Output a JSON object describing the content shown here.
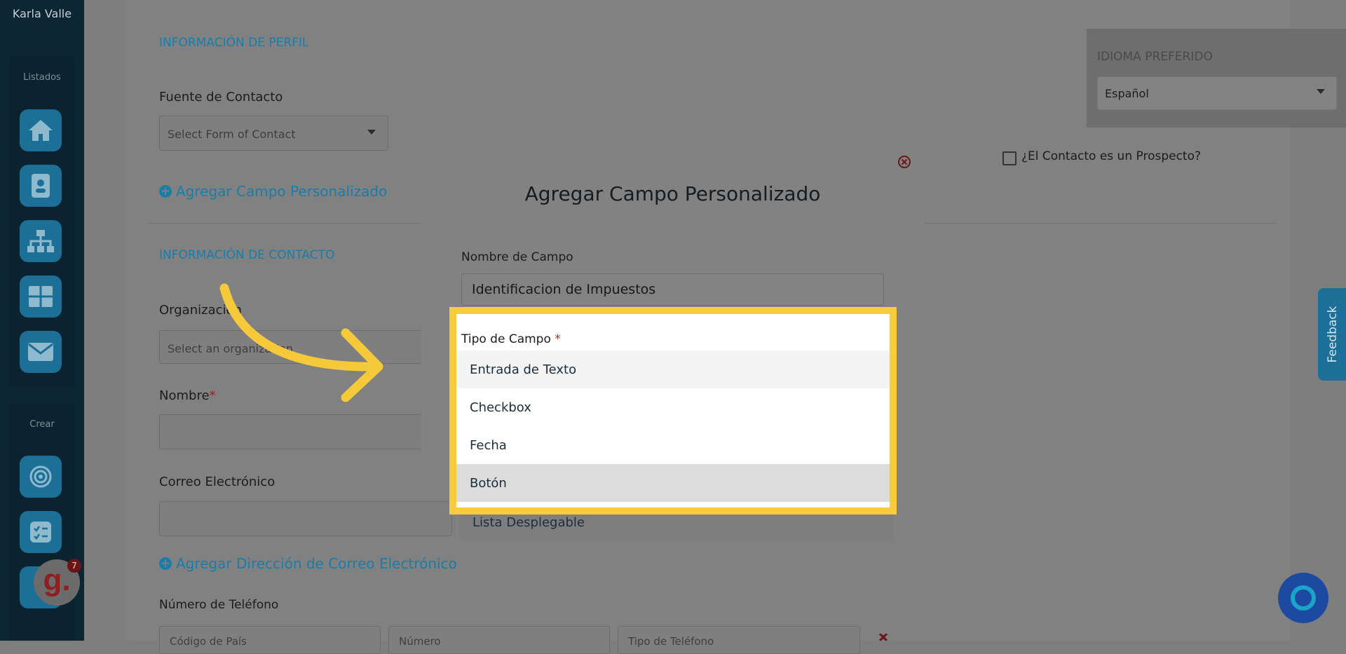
{
  "sidebar": {
    "user_name": "Karla Valle",
    "listados_heading": "Listados",
    "crear_heading": "Crear",
    "items": [
      {
        "icon": "home-icon"
      },
      {
        "icon": "contact-card-icon"
      },
      {
        "icon": "org-chart-icon"
      },
      {
        "icon": "dashboard-grid-icon"
      },
      {
        "icon": "mail-icon"
      },
      {
        "icon": "target-icon"
      },
      {
        "icon": "checklist-icon"
      }
    ],
    "badge_count": "7",
    "badge_letter": "g."
  },
  "profile": {
    "section_title": "INFORMACIÓN DE PERFIL",
    "contact_source_label": "Fuente de Contacto",
    "contact_source_placeholder": "Select Form of Contact",
    "add_custom_field_link": "Agregar Campo Personalizado",
    "preferred_language_label": "IDIOMA PREFERIDO",
    "preferred_language_value": "Español",
    "prospect_label": "¿El Contacto es un Prospecto?"
  },
  "contact": {
    "section_title": "INFORMACIÓN DE CONTACTO",
    "organization_label": "Organización",
    "organization_placeholder": "Select an organization",
    "name_label": "Nombre",
    "name_required_mark": "*",
    "email_label": "Correo Electrónico",
    "add_email_link": "Agregar Dirección de Correo Electrónico",
    "phone_label": "Número de Teléfono",
    "phone_country_placeholder": "Código de País",
    "phone_number_placeholder": "Número",
    "phone_type_placeholder": "Tipo de Teléfono",
    "remove_phone_icon": "close-x-icon"
  },
  "modal": {
    "title": "Agregar Campo Personalizado",
    "close_icon": "close-circle-icon",
    "field_name_label": "Nombre de Campo",
    "field_name_value": "Identificacion de Impuestos",
    "field_type_label": "Tipo de Campo",
    "field_type_required_mark": "*",
    "field_type_options": [
      "Entrada de Texto",
      "Checkbox",
      "Fecha",
      "Botón",
      "Lista Desplegable"
    ]
  },
  "feedback_tab": "Feedback",
  "chat_icon": "chat-bubble-icon",
  "annotation": {
    "arrow_icon": "curved-arrow-icon",
    "highlight_color": "#f9cc3c"
  }
}
